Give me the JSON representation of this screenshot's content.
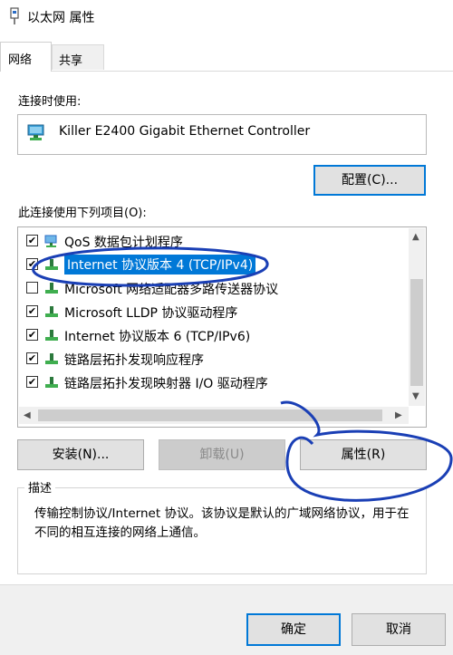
{
  "window": {
    "title": "以太网 属性"
  },
  "tabs": [
    {
      "label": "网络"
    },
    {
      "label": "共享"
    }
  ],
  "connection": {
    "label": "连接时使用:",
    "adapter": "Killer E2400 Gigabit Ethernet Controller"
  },
  "buttons": {
    "configure": "配置(C)...",
    "install": "安装(N)...",
    "uninstall": "卸载(U)",
    "properties": "属性(R)",
    "ok": "确定",
    "cancel": "取消"
  },
  "items_label": "此连接使用下列项目(O):",
  "items": [
    {
      "label": "QoS 数据包计划程序",
      "checked": true
    },
    {
      "label": "Internet 协议版本 4 (TCP/IPv4)",
      "checked": true,
      "selected": true
    },
    {
      "label": "Microsoft 网络适配器多路传送器协议",
      "checked": false
    },
    {
      "label": "Microsoft LLDP 协议驱动程序",
      "checked": true
    },
    {
      "label": "Internet 协议版本 6 (TCP/IPv6)",
      "checked": true
    },
    {
      "label": "链路层拓扑发现响应程序",
      "checked": true
    },
    {
      "label": "链路层拓扑发现映射器 I/O 驱动程序",
      "checked": true
    }
  ],
  "description": {
    "title": "描述",
    "text": "传输控制协议/Internet 协议。该协议是默认的广域网络协议，用于在不同的相互连接的网络上通信。"
  },
  "colors": {
    "accent": "#0078d7",
    "annotation": "#1a3fb5"
  }
}
